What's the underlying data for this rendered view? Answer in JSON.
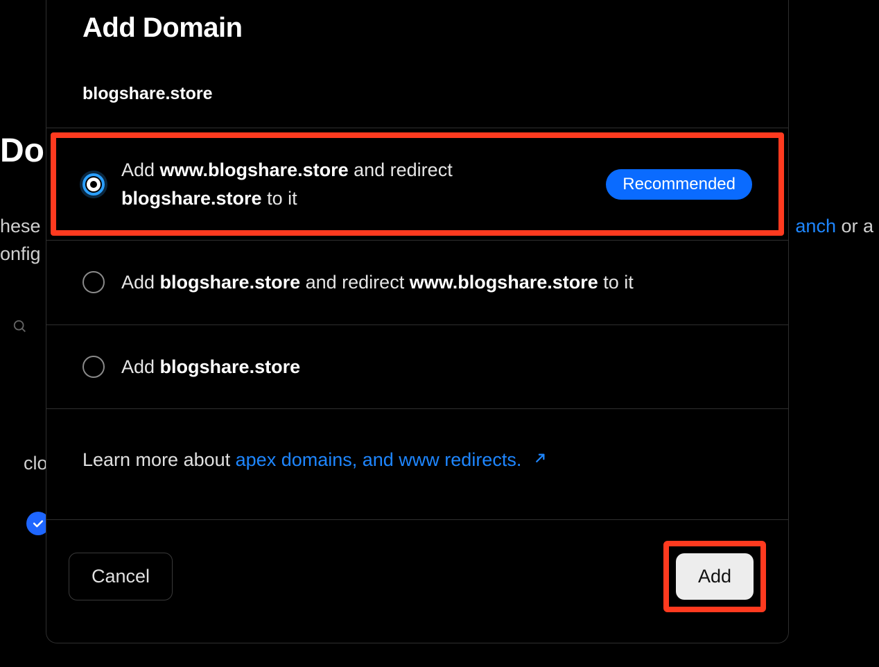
{
  "background": {
    "heading_fragment": "Dom",
    "line1_fragment": "hese",
    "line2_fragment": "onfig",
    "link_fragment": "anch",
    "or_a": " or a",
    "item_fragment": "clo"
  },
  "modal": {
    "title": "Add Domain",
    "subtitle": "blogshare.store",
    "options": [
      {
        "pre": "Add ",
        "bold1": "www.blogshare.store",
        "mid": " and redirect ",
        "bold2": "blogshare.store",
        "post": " to it",
        "selected": true,
        "badge": "Recommended"
      },
      {
        "pre": "Add ",
        "bold1": "blogshare.store",
        "mid": " and redirect ",
        "bold2": "www.blogshare.store",
        "post": " to it",
        "selected": false
      },
      {
        "pre": "Add ",
        "bold1": "blogshare.store",
        "mid": "",
        "bold2": "",
        "post": "",
        "selected": false
      }
    ],
    "learn_prefix": "Learn more about ",
    "learn_link": "apex domains, and www redirects.",
    "footer": {
      "cancel": "Cancel",
      "add": "Add"
    }
  }
}
